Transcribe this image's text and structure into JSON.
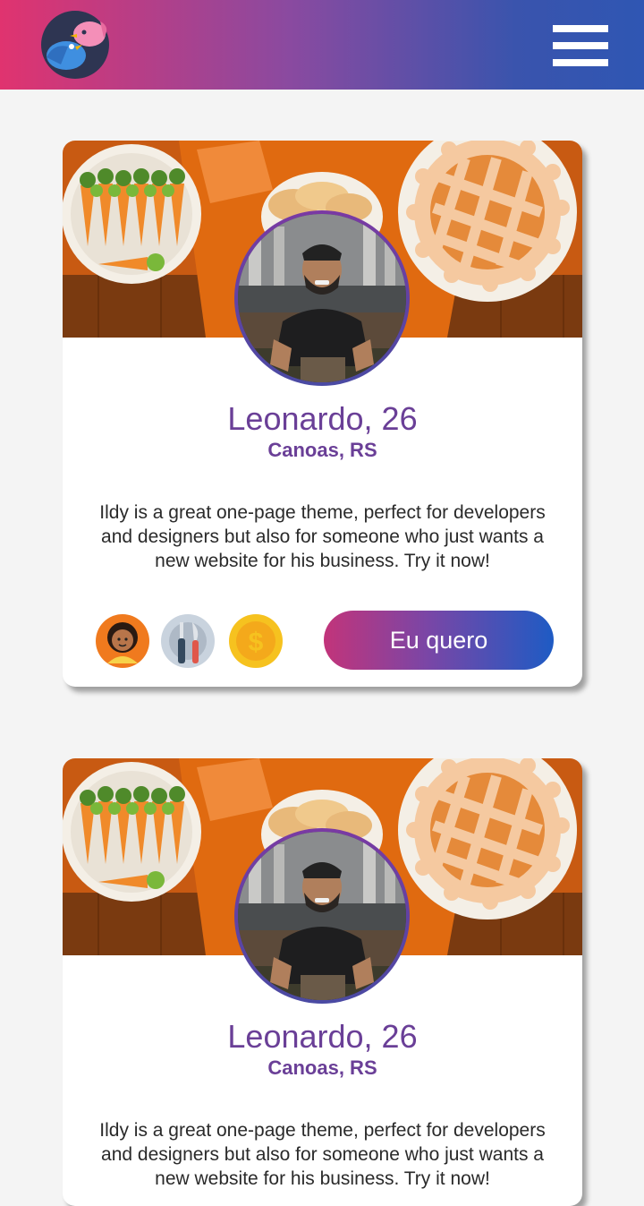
{
  "header": {
    "logo_icon": "birds-logo-icon",
    "menu_icon": "hamburger-menu-icon"
  },
  "cards": [
    {
      "name_age": "Leonardo, 26",
      "city": "Canoas, RS",
      "description": "Ildy is a great one-page theme, perfect for developers and designers but also for someone who just wants a new website for his business. Try it now!",
      "interests": [
        "child-icon",
        "plate-cutlery-icon",
        "dollar-coin-icon"
      ],
      "cta_label": "Eu quero"
    },
    {
      "name_age": "Leonardo, 26",
      "city": "Canoas, RS",
      "description": "Ildy is a great one-page theme, perfect for developers and designers but also for someone who just wants a new website for his business. Try it now!"
    }
  ],
  "colors": {
    "header_gradient_start": "#e0336f",
    "header_gradient_end": "#2f56b3",
    "accent_purple": "#6a3f97",
    "cta_gradient_start": "#c2347a",
    "cta_gradient_end": "#1e5bc4"
  }
}
